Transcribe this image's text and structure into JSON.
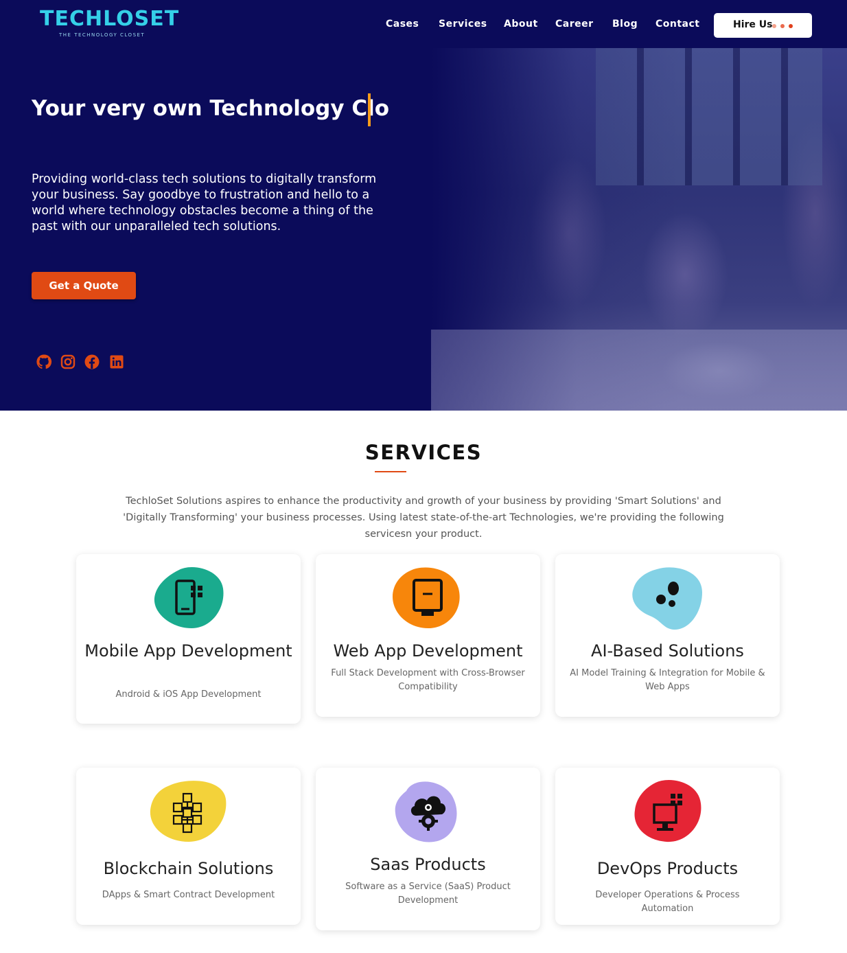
{
  "header": {
    "logo_text": "TECHLOSET",
    "logo_tagline": "THE TECHNOLOGY CLOSET",
    "nav": [
      "Cases",
      "Services",
      "About",
      "Career",
      "Blog",
      "Contact"
    ],
    "hire_label": "Hire Us",
    "hire_dot_colors": [
      "#f3a08a",
      "#ea6a4e",
      "#e0401c"
    ]
  },
  "hero": {
    "title": "Your very own Technology Clo",
    "description": "Providing world-class tech solutions to digitally transform your business. Say goodbye to frustration and hello to a world where technology obstacles become a thing of the past with our unparalleled tech solutions.",
    "cta_label": "Get a Quote",
    "social_icons": [
      "github-icon",
      "instagram-icon",
      "facebook-icon",
      "linkedin-icon"
    ],
    "accent_color": "#e04a14"
  },
  "services": {
    "heading": "SERVICES",
    "description": "TechloSet Solutions aspires to enhance the productivity and growth of your business by providing 'Smart Solutions' and 'Digitally Transforming' your business processes. Using latest state-of-the-art Technologies, we're providing the following servicesn your product.",
    "items": [
      {
        "title": "Mobile App Development",
        "subtitle": "Android & iOS App Development",
        "icon": "mobile-app-icon",
        "color": "#1aab8e"
      },
      {
        "title": "Web App Development",
        "subtitle": "Full Stack Development with Cross-Browser Compatibility",
        "icon": "monitor-icon",
        "color": "#f7860b"
      },
      {
        "title": "AI-Based Solutions",
        "subtitle": "AI Model Training & Integration for Mobile & Web Apps",
        "icon": "ai-dots-icon",
        "color": "#84d2e6"
      },
      {
        "title": "Blockchain Solutions",
        "subtitle": "DApps & Smart Contract Development",
        "icon": "blockchain-icon",
        "color": "#f3d23a"
      },
      {
        "title": "Saas Products",
        "subtitle": "Software as a Service (SaaS) Product Development",
        "icon": "cloud-gear-icon",
        "color": "#b3a6ee"
      },
      {
        "title": "DevOps Products",
        "subtitle": "Developer Operations & Process Automation",
        "icon": "devops-monitor-icon",
        "color": "#e52535"
      }
    ]
  }
}
